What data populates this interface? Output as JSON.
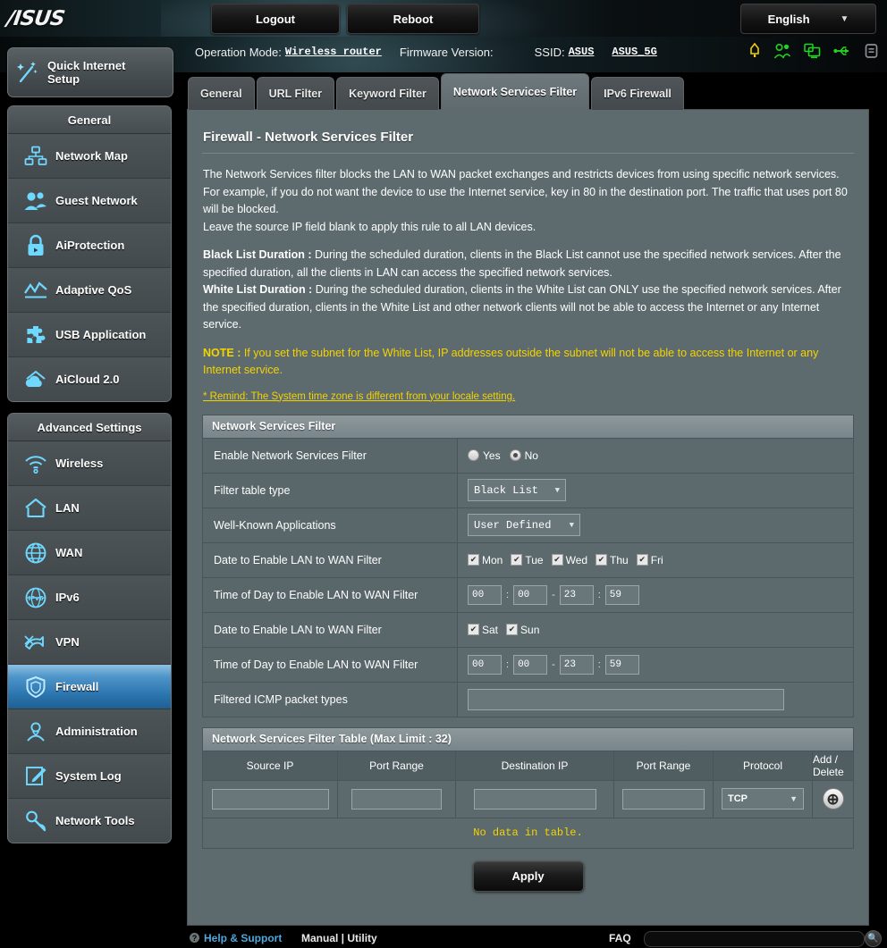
{
  "brand": {
    "logo_text": "/ISUS"
  },
  "topbar": {
    "logout_label": "Logout",
    "reboot_label": "Reboot",
    "language": "English",
    "caret": "▼"
  },
  "infobar": {
    "operation_mode_label": "Operation Mode:",
    "operation_mode_value": "Wireless router",
    "firmware_label": "Firmware Version:",
    "firmware_value": "",
    "ssid_label": "SSID:",
    "ssid_value_1": "ASUS",
    "ssid_value_2": "ASUS_5G",
    "icons": [
      "warning-icon",
      "guest-network-icon",
      "client-status-icon",
      "usb-icon",
      "printer-icon"
    ]
  },
  "quick_setup": {
    "label_line1": "Quick Internet",
    "label_line2": "Setup",
    "icon": "magic-wand-icon"
  },
  "sidebar": {
    "groups": [
      {
        "title": "General",
        "items": [
          {
            "label": "Network Map",
            "icon": "network-map-icon",
            "active": false
          },
          {
            "label": "Guest Network",
            "icon": "guest-network-icon",
            "active": false
          },
          {
            "label": "AiProtection",
            "icon": "lock-icon",
            "active": false
          },
          {
            "label": "Adaptive QoS",
            "icon": "chart-icon",
            "active": false
          },
          {
            "label": "USB Application",
            "icon": "puzzle-icon",
            "active": false
          },
          {
            "label": "AiCloud 2.0",
            "icon": "cloud-home-icon",
            "active": false
          }
        ]
      },
      {
        "title": "Advanced Settings",
        "items": [
          {
            "label": "Wireless",
            "icon": "wifi-icon",
            "active": false
          },
          {
            "label": "LAN",
            "icon": "home-icon",
            "active": false
          },
          {
            "label": "WAN",
            "icon": "globe-icon",
            "active": false
          },
          {
            "label": "IPv6",
            "icon": "ipv6-globe-icon",
            "active": false
          },
          {
            "label": "VPN",
            "icon": "vpn-icon",
            "active": false
          },
          {
            "label": "Firewall",
            "icon": "shield-icon",
            "active": true
          },
          {
            "label": "Administration",
            "icon": "user-icon",
            "active": false
          },
          {
            "label": "System Log",
            "icon": "log-pencil-icon",
            "active": false
          },
          {
            "label": "Network Tools",
            "icon": "wrench-icon",
            "active": false
          }
        ]
      }
    ]
  },
  "tabs": [
    {
      "label": "General",
      "active": false
    },
    {
      "label": "URL Filter",
      "active": false
    },
    {
      "label": "Keyword Filter",
      "active": false
    },
    {
      "label": "Network Services Filter",
      "active": true
    },
    {
      "label": "IPv6 Firewall",
      "active": false
    }
  ],
  "page": {
    "title": "Firewall - Network Services Filter",
    "desc_p1": "The Network Services filter blocks the LAN to WAN packet exchanges and restricts devices from using specific network services.",
    "desc_p2": "For example, if you do not want the device to use the Internet service, key in 80 in the destination port. The traffic that uses port 80 will be blocked.",
    "desc_p3": "Leave the source IP field blank to apply this rule to all LAN devices.",
    "black_label": "Black List Duration :",
    "black_text": " During the scheduled duration, clients in the Black List cannot use the specified network services. After the specified duration, all the clients in LAN can access the specified network services.",
    "white_label": "White List Duration :",
    "white_text": " During the scheduled duration, clients in the White List can ONLY use the specified network services. After the specified duration, clients in the White List and other network clients will not be able to access the Internet or any Internet service.",
    "note_label": "NOTE :",
    "note_text": " If you set the subnet for the White List, IP addresses outside the subnet will not be able to access the Internet or any Internet service.",
    "remind": "* Remind: The System time zone is different from your locale setting."
  },
  "form": {
    "section_title": "Network Services Filter",
    "enable_label": "Enable Network Services Filter",
    "enable_yes": "Yes",
    "enable_no": "No",
    "enable_value": "No",
    "filter_type_label": "Filter table type",
    "filter_type_value": "Black List",
    "well_known_label": "Well-Known Applications",
    "well_known_value": "User Defined",
    "date_label_1": "Date to Enable LAN to WAN Filter",
    "weekdays": [
      {
        "label": "Mon",
        "checked": true
      },
      {
        "label": "Tue",
        "checked": true
      },
      {
        "label": "Wed",
        "checked": true
      },
      {
        "label": "Thu",
        "checked": true
      },
      {
        "label": "Fri",
        "checked": true
      }
    ],
    "time_label_1": "Time of Day to Enable LAN to WAN Filter",
    "time_1": {
      "start_h": "00",
      "start_m": "00",
      "end_h": "23",
      "end_m": "59"
    },
    "date_label_2": "Date to Enable LAN to WAN Filter",
    "weekend": [
      {
        "label": "Sat",
        "checked": true
      },
      {
        "label": "Sun",
        "checked": true
      }
    ],
    "time_label_2": "Time of Day to Enable LAN to WAN Filter",
    "time_2": {
      "start_h": "00",
      "start_m": "00",
      "end_h": "23",
      "end_m": "59"
    },
    "icmp_label": "Filtered ICMP packet types",
    "icmp_value": "",
    "time_sep_colon": ":",
    "time_sep_dash": "-",
    "caret": "▼"
  },
  "table": {
    "title": "Network Services Filter Table (Max Limit : 32)",
    "headers": [
      "Source IP",
      "Port Range",
      "Destination IP",
      "Port Range",
      "Protocol",
      "Add / Delete"
    ],
    "entry_row": {
      "source_ip": "",
      "port_range_1": "",
      "destination_ip": "",
      "port_range_2": "",
      "protocol": "TCP",
      "add_icon": "⊕"
    },
    "empty_text": "No data in table."
  },
  "apply": {
    "label": "Apply"
  },
  "footer": {
    "help_label": "Help & Support",
    "manual_label": "Manual | Utility",
    "faq_label": "FAQ",
    "faq_value": "",
    "search_icon": "🔍"
  },
  "colors": {
    "panel_bg": "#5e6b6e",
    "accent_blue": "#2a74ad",
    "note_yellow": "#f5d300",
    "link_blue": "#4ea8dd"
  }
}
